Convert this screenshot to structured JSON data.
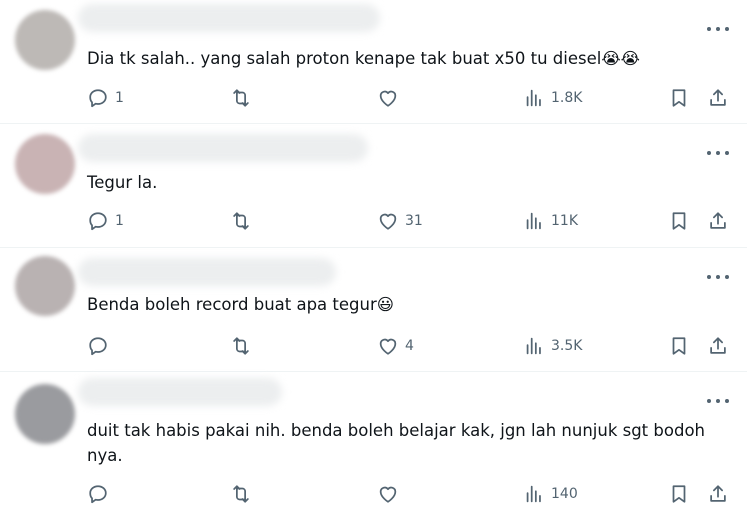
{
  "posts": [
    {
      "text": "Dia tk salah.. yang salah proton kenape tak buat x50 tu diesel😭😭",
      "replies": "1",
      "retweets": "",
      "likes": "",
      "views": "1.8K",
      "avatar_color": "#bdb9b6"
    },
    {
      "text": "Tegur la.",
      "replies": "1",
      "retweets": "",
      "likes": "31",
      "views": "11K",
      "avatar_color": "#c9b3b4"
    },
    {
      "text": "Benda boleh record buat apa tegur😃",
      "replies": "",
      "retweets": "",
      "likes": "4",
      "views": "3.5K",
      "avatar_color": "#b9b2b2"
    },
    {
      "text": "duit tak habis pakai nih. benda boleh belajar kak, jgn lah nunjuk sgt bodoh nya.",
      "replies": "",
      "retweets": "",
      "likes": "",
      "views": "140",
      "avatar_color": "#9a9b9f"
    }
  ],
  "icons": {
    "reply": "reply-icon",
    "retweet": "retweet-icon",
    "like": "like-icon",
    "views": "views-icon",
    "bookmark": "bookmark-icon",
    "share": "share-icon",
    "more": "more-icon"
  },
  "colors": {
    "icon": "#536471",
    "text": "#0f1419",
    "divider": "#eff3f4"
  }
}
